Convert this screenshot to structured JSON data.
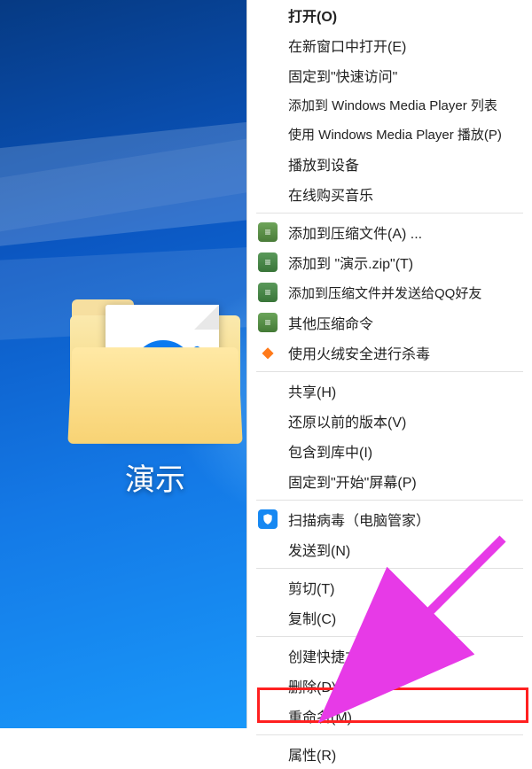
{
  "folder_label": "演示",
  "menu": {
    "open": "打开(O)",
    "open_new": "在新窗口中打开(E)",
    "pin_quick": "固定到\"快速访问\"",
    "wmp_list": "添加到 Windows Media Player 列表",
    "wmp_play": "使用 Windows Media Player 播放(P)",
    "cast": "播放到设备",
    "buy_music": "在线购买音乐",
    "zip_a": "添加到压缩文件(A) ...",
    "zip_t": "添加到 \"演示.zip\"(T)",
    "zip_qq": "添加到压缩文件并发送给QQ好友",
    "zip_other": "其他压缩命令",
    "huorong": "使用火绒安全进行杀毒",
    "share": "共享(H)",
    "restore": "还原以前的版本(V)",
    "include": "包含到库中(I)",
    "pin_start": "固定到\"开始\"屏幕(P)",
    "scan_qq": "扫描病毒（电脑管家）",
    "send_to": "发送到(N)",
    "cut": "剪切(T)",
    "copy": "复制(C)",
    "shortcut": "创建快捷方式(S)",
    "delete": "删除(D)",
    "rename": "重命名(M)",
    "properties": "属性(R)"
  }
}
